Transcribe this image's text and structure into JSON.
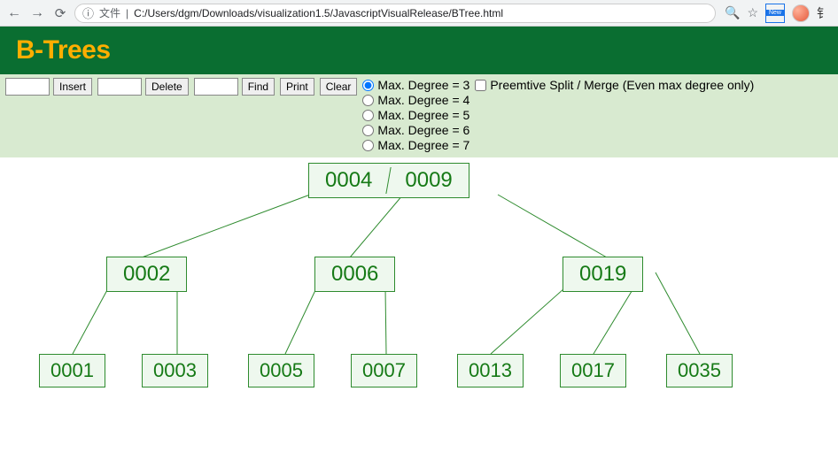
{
  "browser": {
    "security_label": "文件",
    "url": "C:/Users/dgm/Downloads/visualization1.5/JavascriptVisualRelease/BTree.html",
    "ext_badge_top": "▄",
    "ext_badge_bottom": "New"
  },
  "header": {
    "title": "B-Trees"
  },
  "controls": {
    "insert_btn": "Insert",
    "delete_btn": "Delete",
    "find_btn": "Find",
    "print_btn": "Print",
    "clear_btn": "Clear",
    "insert_val": "",
    "delete_val": "",
    "find_val": "",
    "degree_options": [
      {
        "label": "Max. Degree = 3",
        "checked": true
      },
      {
        "label": "Max. Degree = 4",
        "checked": false
      },
      {
        "label": "Max. Degree = 5",
        "checked": false
      },
      {
        "label": "Max. Degree = 6",
        "checked": false
      },
      {
        "label": "Max. Degree = 7",
        "checked": false
      }
    ],
    "preemptive_label": "Preemtive Split / Merge (Even max degree only)",
    "preemptive_checked": false
  },
  "tree": {
    "root": {
      "keys": [
        "0004",
        "0009"
      ]
    },
    "mid": [
      {
        "keys": [
          "0002"
        ]
      },
      {
        "keys": [
          "0006"
        ]
      },
      {
        "keys": [
          "0019"
        ]
      }
    ],
    "leaves": [
      {
        "keys": [
          "0001"
        ]
      },
      {
        "keys": [
          "0003"
        ]
      },
      {
        "keys": [
          "0005"
        ]
      },
      {
        "keys": [
          "0007"
        ]
      },
      {
        "keys": [
          "0013"
        ]
      },
      {
        "keys": [
          "0017"
        ]
      },
      {
        "keys": [
          "0035"
        ]
      }
    ]
  },
  "chart_data": {
    "type": "tree",
    "structure": "B-Tree, max degree 3",
    "root": [
      "0004",
      "0009"
    ],
    "children": [
      {
        "keys": [
          "0002"
        ],
        "children": [
          [
            "0001"
          ],
          [
            "0003"
          ]
        ]
      },
      {
        "keys": [
          "0006"
        ],
        "children": [
          [
            "0005"
          ],
          [
            "0007"
          ]
        ]
      },
      {
        "keys": [
          "0019"
        ],
        "children": [
          [
            "0013"
          ],
          [
            "0017"
          ],
          [
            "0035"
          ]
        ]
      }
    ]
  },
  "colors": {
    "banner": "#0a6e31",
    "title": "#ffae00",
    "panel": "#d8ead0",
    "node_border": "#2e8b2e",
    "node_fill": "#eef8ee",
    "node_text": "#167a16"
  }
}
